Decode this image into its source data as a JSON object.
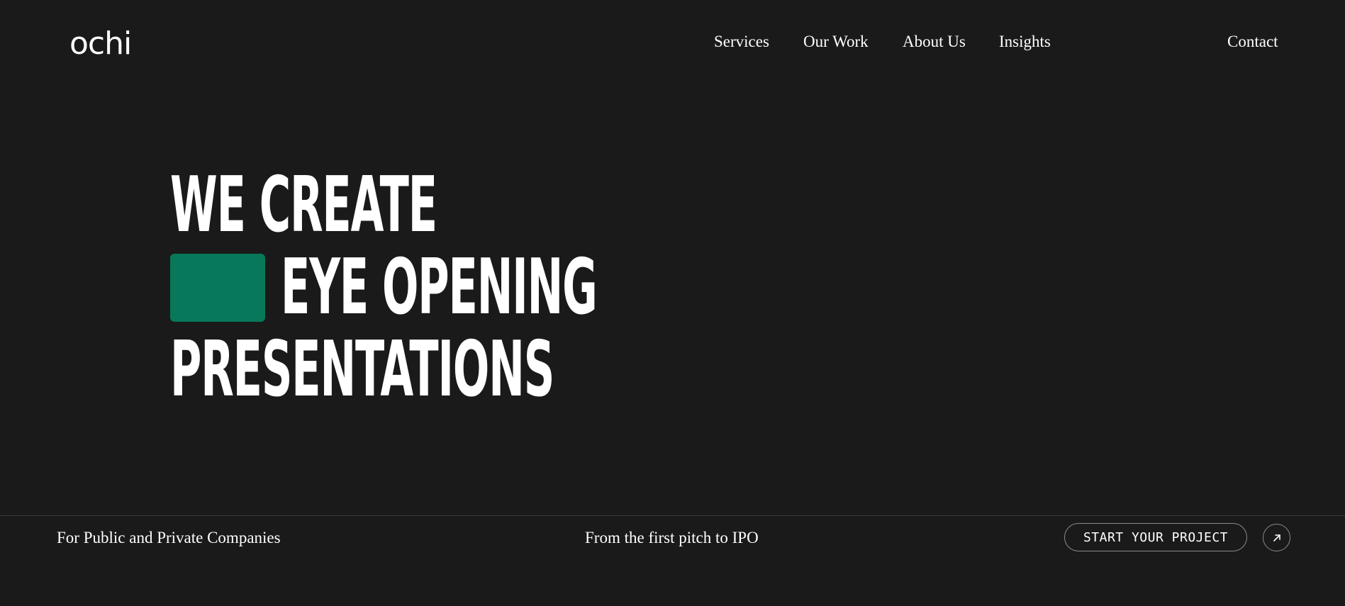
{
  "header": {
    "logo_text": "ochi",
    "nav": [
      {
        "label": "Services"
      },
      {
        "label": "Our Work"
      },
      {
        "label": "About Us"
      },
      {
        "label": "Insights"
      }
    ],
    "contact_label": "Contact"
  },
  "hero": {
    "lines": [
      "WE CREATE",
      "EYE OPENING",
      "PRESENTATIONS"
    ],
    "accent_color": "#08785a"
  },
  "footer": {
    "left_text": "For Public and Private Companies",
    "center_text": "From the first pitch to IPO",
    "cta_label": "START YOUR PROJECT",
    "arrow_icon": "arrow-up-right-icon"
  },
  "colors": {
    "background": "#1a1a1b",
    "text": "#ffffff",
    "accent": "#08785a"
  }
}
